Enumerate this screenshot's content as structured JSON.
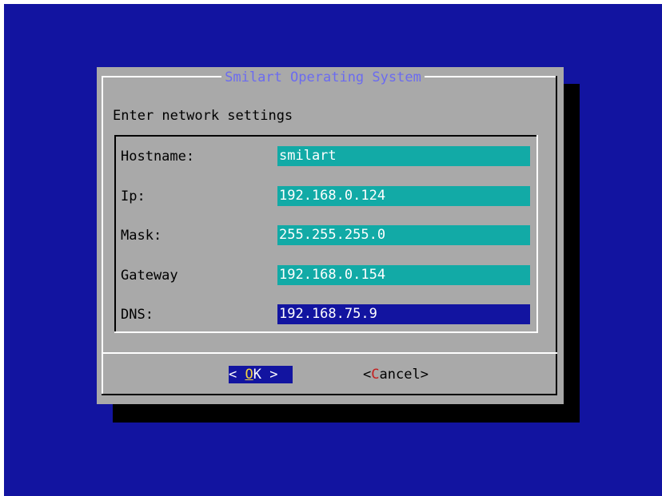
{
  "dialog": {
    "title": "Smilart Operating System",
    "heading": "Enter network settings"
  },
  "fields": [
    {
      "label": "Hostname:",
      "value": "smilart",
      "focused": false
    },
    {
      "label": "Ip:",
      "value": "192.168.0.124",
      "focused": false
    },
    {
      "label": "Mask:",
      "value": "255.255.255.0",
      "focused": false
    },
    {
      "label": "Gateway",
      "value": "192.168.0.154",
      "focused": false
    },
    {
      "label": "DNS:",
      "value": "192.168.75.9",
      "focused": true
    }
  ],
  "buttons": {
    "ok": {
      "prefix": "< ",
      "hotkey": "O",
      "rest": "K",
      "suffix": " >",
      "selected": true
    },
    "cancel": {
      "prefix": "<",
      "hotkey": "C",
      "rest": "ancel",
      "suffix": ">",
      "selected": false
    }
  },
  "colors": {
    "screen_background": "#1214a0",
    "dialog_background": "#a9a9a9",
    "title_text": "#6b6bf0",
    "input_background": "#12aaa6",
    "focused_input_background": "#1214a0",
    "ok_hotkey": "#f4d442",
    "cancel_hotkey": "#c42020"
  }
}
